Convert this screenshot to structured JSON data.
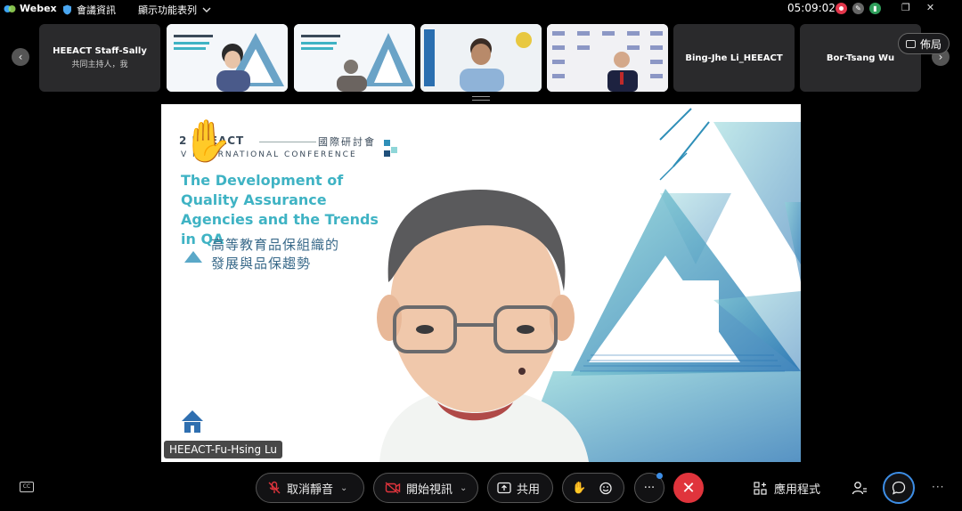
{
  "app": {
    "name": "Webex",
    "meeting_info_label": "會議資訊",
    "view_menu_label": "顯示功能表列",
    "clock": "05:09:02"
  },
  "filmstrip": {
    "layout_label": "佈局",
    "tiles": [
      {
        "name": "HEEACT Staff-Sally",
        "role": "共同主持人，我"
      },
      {
        "name": "",
        "role": ""
      },
      {
        "name": "",
        "role": ""
      },
      {
        "name": "",
        "role": ""
      },
      {
        "name": "",
        "role": ""
      },
      {
        "name": "Bing-Jhe Li_HEEACT",
        "role": ""
      },
      {
        "name": "Bor-Tsang Wu",
        "role": ""
      }
    ]
  },
  "main_video": {
    "slide_year": "2  HEEACT",
    "slide_cjk_conf": "國際研討會",
    "slide_sub": "V    INTERNATIONAL CONFERENCE",
    "slide_title": "The Development of Quality Assurance Agencies and the Trends in QA",
    "slide_cjk_title_1": "高等教育品保組織的",
    "slide_cjk_title_2": "發展與品保趨勢",
    "speaker_name": "HEEACT-Fu-Hsing Lu"
  },
  "toolbar": {
    "mute_label": "取消靜音",
    "video_label": "開始視訊",
    "share_label": "共用",
    "apps_label": "應用程式",
    "more_label": "···",
    "cc_label": "CC"
  },
  "colors": {
    "accent": "#3fb3c4",
    "end_call": "#e0343c",
    "chat_ring": "#3d8ee6"
  }
}
